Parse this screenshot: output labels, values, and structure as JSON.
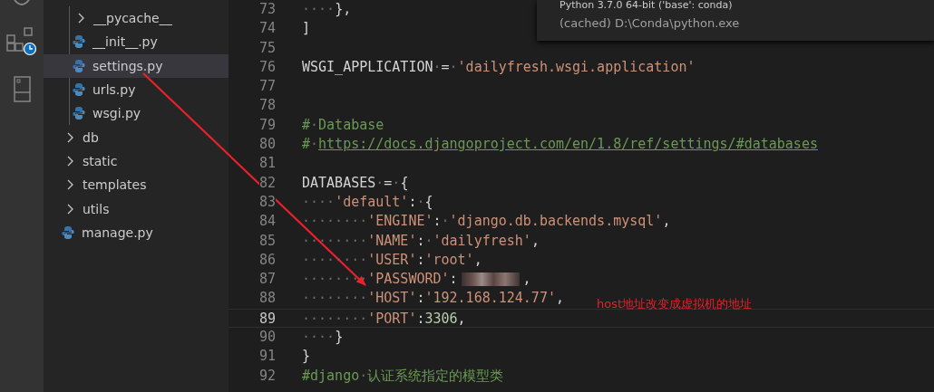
{
  "activity_bar": {
    "items": [
      {
        "kind": "partial"
      },
      {
        "kind": "extensions"
      },
      {
        "kind": "panel"
      }
    ]
  },
  "explorer": {
    "nested_items": [
      {
        "label": "__pycache__",
        "kind": "folder",
        "selected": false
      },
      {
        "label": "__init__.py",
        "kind": "python",
        "selected": false
      },
      {
        "label": "settings.py",
        "kind": "python",
        "selected": true
      },
      {
        "label": "urls.py",
        "kind": "python",
        "selected": false
      },
      {
        "label": "wsgi.py",
        "kind": "python",
        "selected": false
      }
    ],
    "items": [
      {
        "label": "db",
        "kind": "folder",
        "selected": false
      },
      {
        "label": "static",
        "kind": "folder",
        "selected": false
      },
      {
        "label": "templates",
        "kind": "folder",
        "selected": false
      },
      {
        "label": "utils",
        "kind": "folder",
        "selected": false
      },
      {
        "label": "manage.py",
        "kind": "python",
        "selected": false
      }
    ]
  },
  "editor": {
    "lines": [
      {
        "number": "73",
        "current": false,
        "tokens": [
          {
            "kind": "ws",
            "text": "····"
          },
          {
            "kind": "plain",
            "text": "},"
          }
        ]
      },
      {
        "number": "74",
        "current": false,
        "tokens": [
          {
            "kind": "plain",
            "text": "]"
          }
        ]
      },
      {
        "number": "75",
        "current": false
      },
      {
        "number": "76",
        "current": false,
        "tokens": [
          {
            "kind": "plain",
            "text": "WSGI_APPLICATION"
          },
          {
            "kind": "ws",
            "text": "·"
          },
          {
            "kind": "plain",
            "text": "="
          },
          {
            "kind": "ws",
            "text": "·"
          },
          {
            "kind": "string",
            "text": "'dailyfresh.wsgi.application'"
          }
        ]
      },
      {
        "number": "77",
        "current": false
      },
      {
        "number": "78",
        "current": false
      },
      {
        "number": "79",
        "current": false,
        "tokens": [
          {
            "kind": "comment",
            "text": "#"
          },
          {
            "kind": "ws",
            "text": "·"
          },
          {
            "kind": "comment",
            "text": "Database"
          }
        ]
      },
      {
        "number": "80",
        "current": false,
        "tokens": [
          {
            "kind": "comment",
            "text": "#"
          },
          {
            "kind": "ws",
            "text": "·"
          },
          {
            "kind": "link",
            "text": "https://docs.djangoproject.com/en/1.8/ref/settings/#databases"
          }
        ]
      },
      {
        "number": "81",
        "current": false
      },
      {
        "number": "82",
        "current": false,
        "tokens": [
          {
            "kind": "plain",
            "text": "DATABASES"
          },
          {
            "kind": "ws",
            "text": "·"
          },
          {
            "kind": "plain",
            "text": "="
          },
          {
            "kind": "ws",
            "text": "·"
          },
          {
            "kind": "plain",
            "text": "{"
          }
        ]
      },
      {
        "number": "83",
        "current": false,
        "tokens": [
          {
            "kind": "ws",
            "text": "····"
          },
          {
            "kind": "string",
            "text": "'default'"
          },
          {
            "kind": "plain",
            "text": ":"
          },
          {
            "kind": "ws",
            "text": "·"
          },
          {
            "kind": "plain",
            "text": "{"
          }
        ]
      },
      {
        "number": "84",
        "current": false,
        "tokens": [
          {
            "kind": "ws",
            "text": "········"
          },
          {
            "kind": "string",
            "text": "'ENGINE'"
          },
          {
            "kind": "plain",
            "text": ":"
          },
          {
            "kind": "ws",
            "text": "·"
          },
          {
            "kind": "string",
            "text": "'django.db.backends.mysql'"
          },
          {
            "kind": "plain",
            "text": ","
          }
        ]
      },
      {
        "number": "85",
        "current": false,
        "tokens": [
          {
            "kind": "ws",
            "text": "········"
          },
          {
            "kind": "string",
            "text": "'NAME'"
          },
          {
            "kind": "plain",
            "text": ":"
          },
          {
            "kind": "ws",
            "text": "·"
          },
          {
            "kind": "string",
            "text": "'dailyfresh'"
          },
          {
            "kind": "plain",
            "text": ","
          }
        ]
      },
      {
        "number": "86",
        "current": false,
        "tokens": [
          {
            "kind": "ws",
            "text": "········"
          },
          {
            "kind": "string",
            "text": "'USER'"
          },
          {
            "kind": "plain",
            "text": ":"
          },
          {
            "kind": "string",
            "text": "'root'"
          },
          {
            "kind": "plain",
            "text": ","
          }
        ]
      },
      {
        "number": "87",
        "current": false,
        "tokens": [
          {
            "kind": "ws",
            "text": "········"
          },
          {
            "kind": "string",
            "text": "'PASSWORD'"
          },
          {
            "kind": "plain",
            "text": ":"
          },
          {
            "kind": "redacted"
          },
          {
            "kind": "plain",
            "text": ","
          }
        ]
      },
      {
        "number": "88",
        "current": false,
        "tokens": [
          {
            "kind": "ws",
            "text": "········"
          },
          {
            "kind": "string",
            "text": "'HOST'"
          },
          {
            "kind": "plain",
            "text": ":"
          },
          {
            "kind": "string",
            "text": "'192.168.124.77'"
          },
          {
            "kind": "plain",
            "text": ","
          }
        ]
      },
      {
        "number": "89",
        "current": true,
        "tokens": [
          {
            "kind": "ws",
            "text": "········"
          },
          {
            "kind": "string",
            "text": "'PORT'"
          },
          {
            "kind": "plain",
            "text": ":"
          },
          {
            "kind": "number",
            "text": "3306"
          },
          {
            "kind": "plain",
            "text": ","
          }
        ]
      },
      {
        "number": "90",
        "current": false,
        "tokens": [
          {
            "kind": "ws",
            "text": "····"
          },
          {
            "kind": "plain",
            "text": "}"
          }
        ]
      },
      {
        "number": "91",
        "current": false,
        "tokens": [
          {
            "kind": "plain",
            "text": "}"
          }
        ]
      },
      {
        "number": "92",
        "current": false,
        "tokens": [
          {
            "kind": "comment",
            "text": "#django"
          },
          {
            "kind": "ws",
            "text": "·"
          },
          {
            "kind": "comment",
            "text": "认证系统指定的模型类"
          }
        ]
      }
    ]
  },
  "tooltip": {
    "lines": [
      "Python 3.7.0 64-bit ('base': conda)",
      "(cached) D:\\Conda\\python.exe"
    ]
  },
  "annotation": {
    "text": "host地址改变成虚拟机的地址"
  }
}
